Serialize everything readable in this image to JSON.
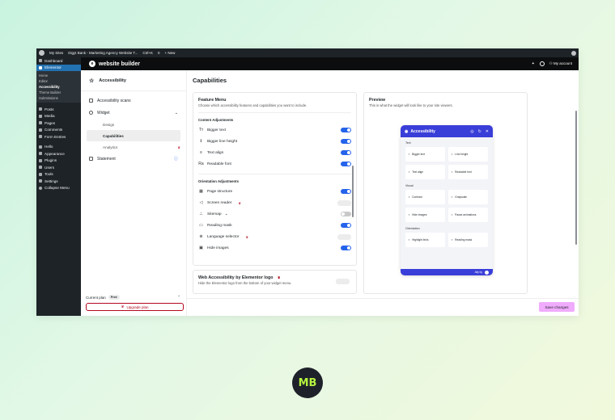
{
  "adminbar": {
    "my_sites": "My Sites",
    "site": "Digyt Bank - Marketing Agency Website T...",
    "search": "Ctrl+K",
    "comments": "0",
    "new": "+ New"
  },
  "wp_menu": {
    "items": [
      "Dashboard",
      "Elementor"
    ],
    "sub": [
      "Home",
      "Editor",
      "Accessibility",
      "Theme Builder",
      "Submissions"
    ],
    "items2": [
      "Posts",
      "Media",
      "Pages",
      "Comments",
      "Form Entries",
      "Hello",
      "Appearance",
      "Plugins",
      "Users",
      "Tools",
      "Settings",
      "Collapse Menu"
    ]
  },
  "topbar": {
    "title": "website builder",
    "account": "My account"
  },
  "plugin_nav": {
    "header": "Accessibility",
    "items": {
      "scans": "Accessibility scans",
      "widget": "Widget",
      "design": "Design",
      "capabilities": "Capabilities",
      "analytics": "Analytics",
      "statement": "Statement"
    },
    "footer": {
      "current_plan": "Current plan",
      "plan": "Free",
      "upgrade": "Upgrade plan"
    }
  },
  "main": {
    "title": "Capabilities",
    "feature_menu": {
      "title": "Feature Menu",
      "subtitle": "Choose which accessibility features and capabilities you want to include.",
      "content_section": "Content Adjustments",
      "content_items": [
        {
          "label": "Bigger text",
          "glyph": "Tт",
          "state": "on"
        },
        {
          "label": "Bigger line height",
          "glyph": "⇕",
          "state": "on"
        },
        {
          "label": "Text align",
          "glyph": "≡",
          "state": "on"
        },
        {
          "label": "Readable font",
          "glyph": "Ra",
          "state": "on"
        }
      ],
      "orientation_section": "Orientation Adjustments",
      "orientation_items": [
        {
          "label": "Page structure",
          "glyph": "▦",
          "state": "on"
        },
        {
          "label": "Screen reader",
          "glyph": "◁",
          "state": "disabled",
          "pro": true
        },
        {
          "label": "Sitemap",
          "glyph": "⛬",
          "state": "off",
          "chevron": true
        },
        {
          "label": "Reading mask",
          "glyph": "▭",
          "state": "on"
        },
        {
          "label": "Language selector",
          "glyph": "⊕",
          "state": "disabled",
          "pro": true
        },
        {
          "label": "Hide images",
          "glyph": "▣",
          "state": "on"
        }
      ]
    },
    "logo_card": {
      "title": "Web Accessibility by Elementor logo",
      "subtitle": "Hide the Elementor logo from the bottom of your widget menu."
    },
    "preview": {
      "title": "Preview",
      "subtitle": "This is what the widget will look like to your site viewers.",
      "widget_title": "Accessibility",
      "text_label": "Text",
      "text_tiles": [
        "Bigger text",
        "Line height",
        "Text align",
        "Readable font"
      ],
      "visual_label": "Visual",
      "visual_tiles": [
        "Contrast",
        "Grayscale",
        "Hide images",
        "Pause animations"
      ],
      "orientation_label": "Orientation",
      "orientation_tiles": [
        "Highlight links",
        "Reading mask"
      ],
      "footer": "Ally by"
    },
    "save_button": "Save changes"
  },
  "watermark": "MB",
  "colors": {
    "accent_blue": "#3a3ed8",
    "toggle_on": "#2563eb",
    "pro_red": "#b4071f",
    "save_pink": "#f0abfc"
  }
}
